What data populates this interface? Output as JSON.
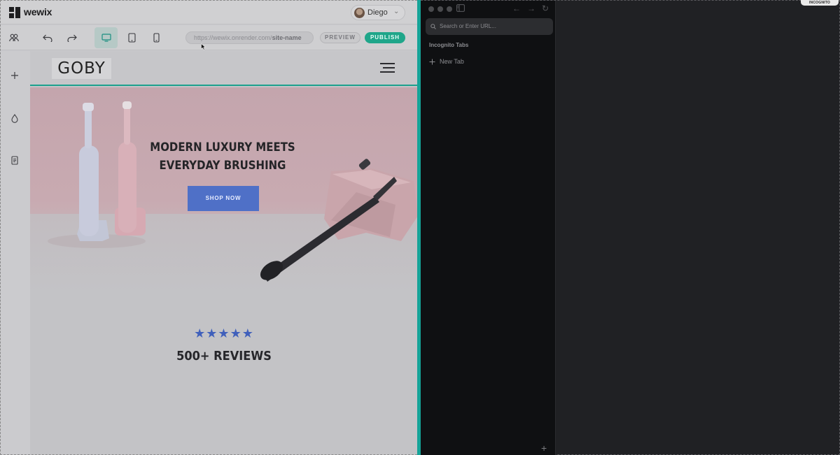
{
  "editor": {
    "app_name": "wewix",
    "user_name": "Diego",
    "toolbar": {
      "url_prefix": "https://wewix.onrender.com/",
      "url_site": "site-name",
      "preview_label": "PREVIEW",
      "publish_label": "PUBLISH"
    }
  },
  "site": {
    "logo": "GOBY",
    "hero_title_line1": "MODERN LUXURY MEETS",
    "hero_title_line2": "EVERYDAY BRUSHING",
    "shop_button": "SHOP NOW",
    "stars": "★★★★★",
    "rating_value": 5,
    "reviews": "500+ REVIEWS"
  },
  "browser": {
    "search_placeholder": "Search or Enter URL...",
    "section_title": "Incognito Tabs",
    "new_tab_label": "New Tab",
    "incognito_badge": "INCOGNITO"
  },
  "colors": {
    "accent_teal": "#1fa68a",
    "shop_button_blue": "#4f70c7",
    "divider": "#15a398"
  }
}
